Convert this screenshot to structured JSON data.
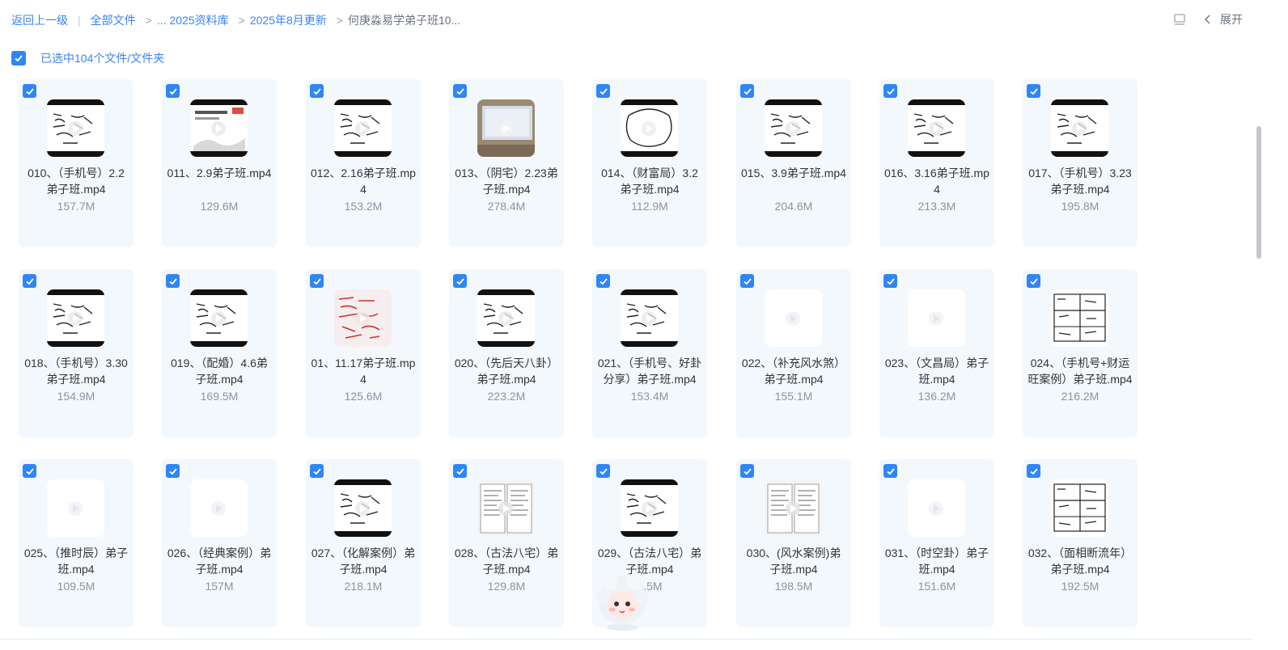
{
  "breadcrumb": {
    "back": "返回上一级",
    "all_files": "全部文件",
    "ellipsis": "...",
    "folder1": "2025资料库",
    "folder2": "2025年8月更新",
    "current": "何庚淼易学弟子班10..."
  },
  "toolbar": {
    "expand_label": "展开"
  },
  "selection": {
    "label": "已选中104个文件/文件夹"
  },
  "colors": {
    "accent": "#2f86f6",
    "card_bg": "#f3f8fd",
    "size_text": "#8a94a3"
  },
  "files": [
    {
      "name": "010、（手机号）2.2弟子班.mp4",
      "size": "157.7M",
      "thumb": "handwriting"
    },
    {
      "name": "011、2.9弟子班.mp4",
      "size": "129.6M",
      "thumb": "slide"
    },
    {
      "name": "012、2.16弟子班.mp4",
      "size": "153.2M",
      "thumb": "handwriting"
    },
    {
      "name": "013、（阴宅）2.23弟子班.mp4",
      "size": "278.4M",
      "thumb": "screen"
    },
    {
      "name": "014、（财富局）3.2弟子班.mp4",
      "size": "112.9M",
      "thumb": "circle"
    },
    {
      "name": "015、3.9弟子班.mp4",
      "size": "204.6M",
      "thumb": "handwriting"
    },
    {
      "name": "016、3.16弟子班.mp4",
      "size": "213.3M",
      "thumb": "handwriting"
    },
    {
      "name": "017、（手机号）3.23弟子班.mp4",
      "size": "195.8M",
      "thumb": "handwriting"
    },
    {
      "name": "018、（手机号）3.30弟子班.mp4",
      "size": "154.9M",
      "thumb": "handwriting"
    },
    {
      "name": "019、（配婚）4.6弟子班.mp4",
      "size": "169.5M",
      "thumb": "handwriting"
    },
    {
      "name": "01、11.17弟子班.mp4",
      "size": "125.6M",
      "thumb": "red"
    },
    {
      "name": "020、（先后天八卦）弟子班.mp4",
      "size": "223.2M",
      "thumb": "handwriting"
    },
    {
      "name": "021、（手机号、好卦分享）弟子班.mp4",
      "size": "153.4M",
      "thumb": "handwriting"
    },
    {
      "name": "022、（补充风水煞）弟子班.mp4",
      "size": "155.1M",
      "thumb": "blank"
    },
    {
      "name": "023、（文昌局）弟子班.mp4",
      "size": "136.2M",
      "thumb": "blank"
    },
    {
      "name": "024、（手机号+财运旺案例）弟子班.mp4",
      "size": "216.2M",
      "thumb": "diagram"
    },
    {
      "name": "025、（推时辰）弟子班.mp4",
      "size": "109.5M",
      "thumb": "blank"
    },
    {
      "name": "026、（经典案例）弟子班.mp4",
      "size": "157M",
      "thumb": "blank"
    },
    {
      "name": "027、（化解案例）弟子班.mp4",
      "size": "218.1M",
      "thumb": "handwriting"
    },
    {
      "name": "028、（古法八宅）弟子班.mp4",
      "size": "129.8M",
      "thumb": "doc"
    },
    {
      "name": "029、（古法八宅）弟子班.mp4",
      "size": "1.5M",
      "thumb": "handwriting"
    },
    {
      "name": "030、(风水案例)弟子班.mp4",
      "size": "198.5M",
      "thumb": "doc"
    },
    {
      "name": "031、（时空卦）弟子班.mp4",
      "size": "151.6M",
      "thumb": "blank"
    },
    {
      "name": "032、（面相断流年）弟子班.mp4",
      "size": "192.5M",
      "thumb": "diagram"
    }
  ]
}
